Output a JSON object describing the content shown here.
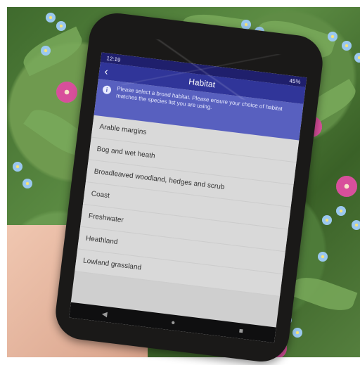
{
  "phone": {
    "status": {
      "time": "12:19",
      "battery": "45%"
    },
    "app_bar": {
      "title": "Habitat",
      "back_icon": "back-arrow-icon"
    },
    "info_banner": {
      "icon": "info-icon",
      "text": "Please select a broad habitat. Please ensure your choice of habitat matches the species list you are using."
    },
    "habitat_options": [
      "Arable margins",
      "Bog and wet heath",
      "Broadleaved woodland, hedges and scrub",
      "Coast",
      "Freshwater",
      "Heathland",
      "Lowland grassland"
    ],
    "nav_icons": [
      "back-triangle-icon",
      "home-circle-icon",
      "recent-square-icon"
    ]
  },
  "scene": {
    "background": "green foliage with blue and pink flowers",
    "colors": {
      "status_bar": "#1f1f6c",
      "app_bar": "#303599",
      "info_banner": "#5860bf",
      "list_background": "#d9d9d9"
    }
  }
}
